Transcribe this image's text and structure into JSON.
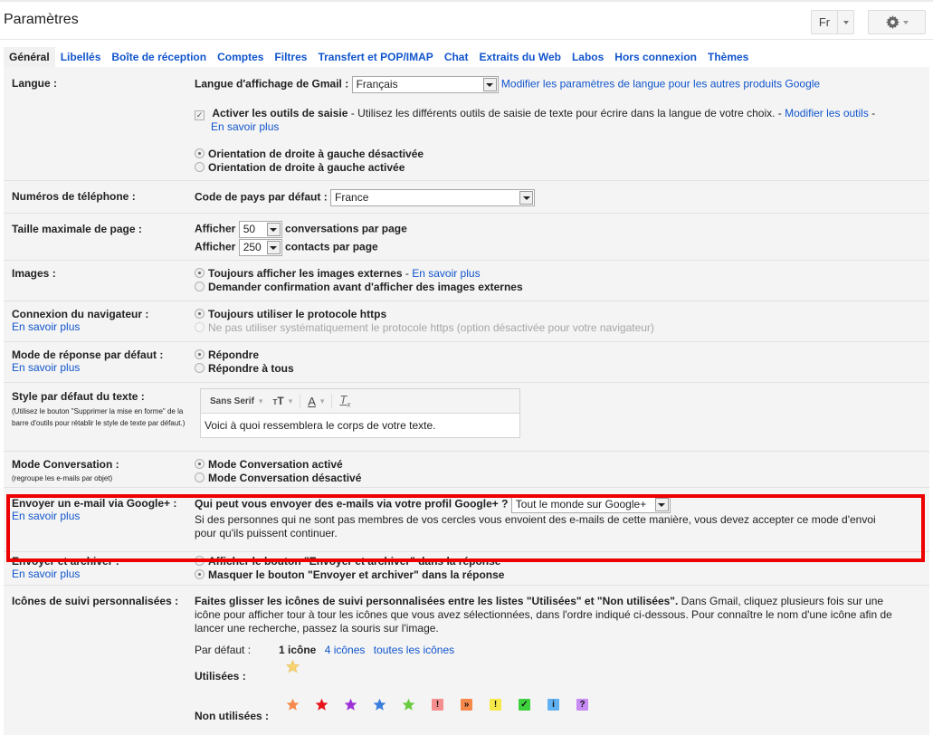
{
  "header": {
    "title": "Paramètres",
    "lang_button": "Fr",
    "settings_icon": "gear-icon"
  },
  "tabs": [
    {
      "label": "Général",
      "active": true
    },
    {
      "label": "Libellés"
    },
    {
      "label": "Boîte de réception"
    },
    {
      "label": "Comptes"
    },
    {
      "label": "Filtres"
    },
    {
      "label": "Transfert et POP/IMAP"
    },
    {
      "label": "Chat"
    },
    {
      "label": "Extraits du Web"
    },
    {
      "label": "Labos"
    },
    {
      "label": "Hors connexion"
    },
    {
      "label": "Thèmes"
    }
  ],
  "langue": {
    "label": "Langue :",
    "display_label": "Langue d'affichage de Gmail :",
    "display_value": "Français",
    "other_products_link": "Modifier les paramètres de langue pour les autres produits Google",
    "input_tools_checked": true,
    "input_tools_bold": "Activer les outils de saisie",
    "input_tools_text": " - Utilisez les différents outils de saisie de texte pour écrire dans la langue de votre choix. - ",
    "modify_tools_link": "Modifier les outils",
    "modify_tools_suffix": " -",
    "learn_more": "En savoir plus",
    "rtl_off": "Orientation de droite à gauche désactivée",
    "rtl_on": "Orientation de droite à gauche activée",
    "rtl_selected": "off"
  },
  "phone": {
    "label": "Numéros de téléphone :",
    "country_label": "Code de pays par défaut :",
    "country_value": "France"
  },
  "page_size": {
    "label": "Taille maximale de page :",
    "show": "Afficher",
    "conversations_value": "50",
    "conversations_suffix": "conversations par page",
    "contacts_value": "250",
    "contacts_suffix": "contacts par page"
  },
  "images": {
    "label": "Images :",
    "always": "Toujours afficher les images externes",
    "sep": " - ",
    "learn_more": "En savoir plus",
    "ask": "Demander confirmation avant d'afficher des images externes",
    "selected": "always"
  },
  "browser": {
    "label": "Connexion du navigateur :",
    "learn_more": "En savoir plus",
    "https_always": "Toujours utiliser le protocole https",
    "https_not_always": "Ne pas utiliser systématiquement le protocole https (option désactivée pour votre navigateur)",
    "selected": "https_always"
  },
  "reply": {
    "label": "Mode de réponse par défaut :",
    "learn_more": "En savoir plus",
    "reply": "Répondre",
    "reply_all": "Répondre à tous",
    "selected": "reply"
  },
  "text_style": {
    "label": "Style par défaut du texte :",
    "hint_line1": "(Utilisez le bouton \"Supprimer la mise en forme\" de la",
    "hint_line2": "barre d'outils pour rétablir le style de texte par défaut.)",
    "font": "Sans Serif",
    "preview": "Voici à quoi ressemblera le corps de votre texte."
  },
  "conversation": {
    "label": "Mode Conversation :",
    "hint": "(regroupe les e-mails par objet)",
    "on": "Mode Conversation activé",
    "off": "Mode Conversation désactivé",
    "selected": "on"
  },
  "gplus": {
    "label": "Envoyer un e-mail via Google+ :",
    "learn_more": "En savoir plus",
    "question": "Qui peut vous envoyer des e-mails via votre profil Google+ ?",
    "value": "Tout le monde sur Google+",
    "desc1": "Si des personnes qui ne sont pas membres de vos cercles vous envoient des e-mails de cette manière, vous devez accepter ce mode d'envoi",
    "desc2": "pour qu'ils puissent continuer.",
    "highlight_color": "#ee0000"
  },
  "send_archive": {
    "label": "Envoyer et archiver :",
    "learn_more": "En savoir plus",
    "show": "Afficher le bouton \"Envoyer et archiver\" dans la réponse",
    "hide": "Masquer le bouton \"Envoyer et archiver\" dans la réponse",
    "selected": "hide"
  },
  "stars": {
    "label": "Icônes de suivi personnalisées :",
    "desc_bold": "Faites glisser les icônes de suivi personnalisées entre les listes \"Utilisées\" et \"Non utilisées\".",
    "desc_rest1": " Dans Gmail, cliquez plusieurs fois sur une",
    "desc_line2": "icône pour afficher tour à tour les icônes que vous avez sélectionnées, dans l'ordre indiqué ci-dessous. Pour connaître le nom d'une icône afin de",
    "desc_line3": "lancer une recherche, passez la souris sur l'image.",
    "presets_label": "Par défaut :",
    "preset_1": "1 icône",
    "preset_4": "4 icônes",
    "preset_all": "toutes les icônes",
    "used_label": "Utilisées :",
    "unused_label": "Non utilisées :",
    "used": [
      {
        "name": "yellow-star-icon",
        "color": "#f7c843"
      }
    ],
    "unused": [
      {
        "name": "orange-star-icon",
        "color": "#f5894b",
        "type": "star"
      },
      {
        "name": "red-star-icon",
        "color": "#e8141b",
        "type": "star"
      },
      {
        "name": "purple-star-icon",
        "color": "#9d32d6",
        "type": "star"
      },
      {
        "name": "blue-star-icon",
        "color": "#3b7ddc",
        "type": "star"
      },
      {
        "name": "green-star-icon",
        "color": "#6acb3f",
        "type": "star"
      },
      {
        "name": "red-bang-icon",
        "color": "#f58f8f",
        "type": "badge",
        "glyph": "!"
      },
      {
        "name": "orange-guillemet-icon",
        "color": "#f5894b",
        "type": "badge",
        "glyph": "»"
      },
      {
        "name": "yellow-bang-icon",
        "color": "#f7e84a",
        "type": "badge",
        "glyph": "!"
      },
      {
        "name": "green-check-icon",
        "color": "#3ed13e",
        "type": "badge",
        "glyph": "✓"
      },
      {
        "name": "blue-info-icon",
        "color": "#61b1f2",
        "type": "badge",
        "glyph": "i"
      },
      {
        "name": "purple-question-icon",
        "color": "#c88af5",
        "type": "badge",
        "glyph": "?"
      }
    ]
  }
}
